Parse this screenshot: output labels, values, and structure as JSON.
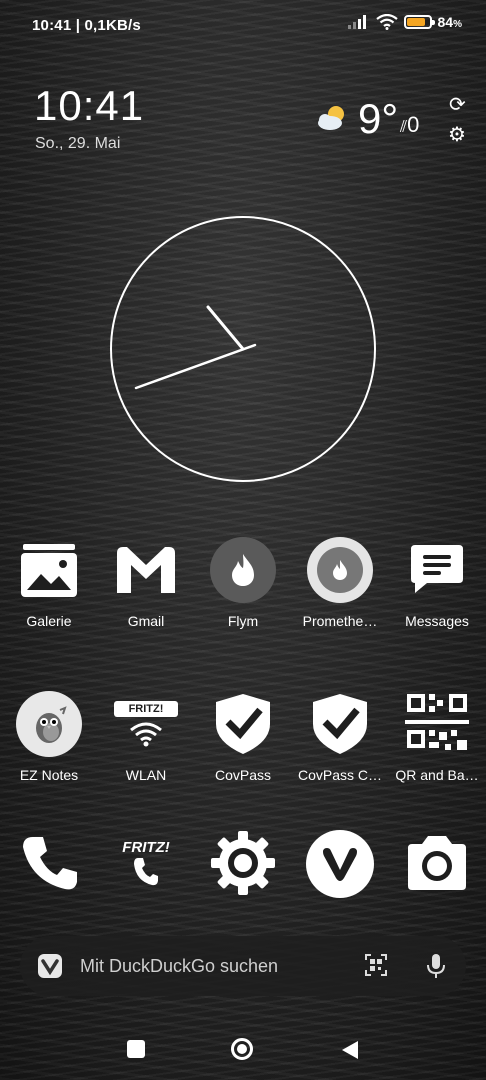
{
  "status_bar": {
    "time": "10:41",
    "speed": "| 0,1KB/s",
    "battery_percent": "84",
    "battery_level": 0.84,
    "battery_color": "#f5a623"
  },
  "clock_widget": {
    "time": "10:41",
    "date": "So., 29. Mai",
    "temperature": "9°",
    "wind": "0",
    "weather_icon": "partly-cloudy-icon"
  },
  "apps_row1": [
    {
      "label": "Galerie",
      "icon": "gallery-icon"
    },
    {
      "label": "Gmail",
      "icon": "gmail-icon"
    },
    {
      "label": "Flym",
      "icon": "flame-icon"
    },
    {
      "label": "Promethe…",
      "icon": "prometheus-icon"
    },
    {
      "label": "Messages",
      "icon": "messages-icon"
    }
  ],
  "apps_row2": [
    {
      "label": "EZ Notes",
      "icon": "ez-notes-icon"
    },
    {
      "label": "WLAN",
      "icon": "fritz-wlan-icon"
    },
    {
      "label": "CovPass",
      "icon": "covpass-icon"
    },
    {
      "label": "CovPass C…",
      "icon": "covpass-check-icon"
    },
    {
      "label": "QR and Ba…",
      "icon": "qr-barcode-icon"
    }
  ],
  "dock": [
    {
      "icon": "phone-icon"
    },
    {
      "icon": "fritz-phone-icon",
      "badge": "FRITZ!"
    },
    {
      "icon": "settings-gear-icon"
    },
    {
      "icon": "vivaldi-icon"
    },
    {
      "icon": "camera-icon"
    }
  ],
  "fritz_badge": "FRITZ!",
  "search": {
    "placeholder": "Mit DuckDuckGo suchen"
  }
}
